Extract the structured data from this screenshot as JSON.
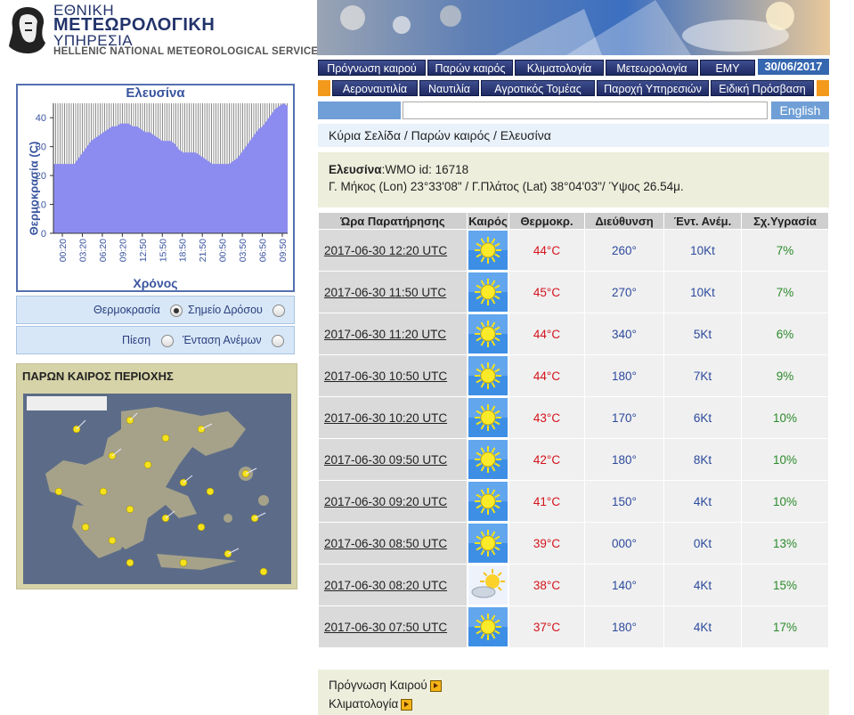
{
  "logo": {
    "line1": "ΕΘΝΙΚΗ",
    "line2": "ΜΕΤΕΩΡΟΛΟΓΙΚΗ",
    "line3": "ΥΠΗΡΕΣΙΑ",
    "line4": "HELLENIC NATIONAL METEOROLOGICAL SERVICE"
  },
  "nav": {
    "row1": [
      "Πρόγνωση καιρού",
      "Παρών καιρός",
      "Κλιματολογία",
      "Μετεωρολογία",
      "ΕΜΥ"
    ],
    "date": "30/06/2017",
    "row2": [
      "Αεροναυτιλία",
      "Ναυτιλία",
      "Αγροτικός Τομέας",
      "Παροχή Υπηρεσιών",
      "Ειδική Πρόσβαση"
    ]
  },
  "search": {
    "english_label": "English",
    "value": ""
  },
  "breadcrumb": "Κύρια Σελίδα / Παρών καιρός / Ελευσίνα",
  "station": {
    "name": "Ελευσίνα",
    "wmo": ":WMO id: 16718",
    "coords": "Γ. Μήκος (Lon) 23°33'08\" / Γ.Πλάτος (Lat) 38°04'03\"/ Ύψος 26.54μ."
  },
  "table": {
    "headers": [
      "Ώρα Παρατήρησης",
      "Καιρός",
      "Θερμοκρ.",
      "Διεύθυνση",
      "Έντ. Ανέμ.",
      "Σχ.Υγρασία"
    ],
    "rows": [
      {
        "time": "2017-06-30 12:20 UTC",
        "icon": "sun-icon",
        "temp": "44°C",
        "dir": "260°",
        "wind": "10Kt",
        "hum": "7%"
      },
      {
        "time": "2017-06-30 11:50 UTC",
        "icon": "sun-icon",
        "temp": "45°C",
        "dir": "270°",
        "wind": "10Kt",
        "hum": "7%"
      },
      {
        "time": "2017-06-30 11:20 UTC",
        "icon": "sun-icon",
        "temp": "44°C",
        "dir": "340°",
        "wind": "5Kt",
        "hum": "6%"
      },
      {
        "time": "2017-06-30 10:50 UTC",
        "icon": "sun-icon",
        "temp": "44°C",
        "dir": "180°",
        "wind": "7Kt",
        "hum": "9%"
      },
      {
        "time": "2017-06-30 10:20 UTC",
        "icon": "sun-icon",
        "temp": "43°C",
        "dir": "170°",
        "wind": "6Kt",
        "hum": "10%"
      },
      {
        "time": "2017-06-30 09:50 UTC",
        "icon": "sun-icon",
        "temp": "42°C",
        "dir": "180°",
        "wind": "8Kt",
        "hum": "10%"
      },
      {
        "time": "2017-06-30 09:20 UTC",
        "icon": "sun-icon",
        "temp": "41°C",
        "dir": "150°",
        "wind": "4Kt",
        "hum": "10%"
      },
      {
        "time": "2017-06-30 08:50 UTC",
        "icon": "sun-icon",
        "temp": "39°C",
        "dir": "000°",
        "wind": "0Kt",
        "hum": "13%"
      },
      {
        "time": "2017-06-30 08:20 UTC",
        "icon": "sun-cloud-icon",
        "temp": "38°C",
        "dir": "140°",
        "wind": "4Kt",
        "hum": "15%"
      },
      {
        "time": "2017-06-30 07:50 UTC",
        "icon": "sun-icon",
        "temp": "37°C",
        "dir": "180°",
        "wind": "4Kt",
        "hum": "17%"
      }
    ]
  },
  "bottom_links": [
    "Πρόγνωση Καιρού",
    "Κλιματολογία"
  ],
  "chart_panel": {
    "title": "Ελευσίνα",
    "ylabel": "Θερμοκρασία (C)",
    "xlabel": "Χρόνος"
  },
  "radios": {
    "row1": [
      {
        "label": "Θερμοκρασία",
        "selected": true
      },
      {
        "label": "Σημείο Δρόσου",
        "selected": false
      }
    ],
    "row2": [
      {
        "label": "Πίεση",
        "selected": false
      },
      {
        "label": "Ένταση Ανέμων",
        "selected": false
      }
    ]
  },
  "region": {
    "title": "ΠΑΡΩΝ ΚΑΙΡΟΣ ΠΕΡΙΟΧΗΣ"
  },
  "colors": {
    "nav_blue": "#1e2a63",
    "chart_fill": "#8c8cf0",
    "temp_red": "#d4121b",
    "hum_green": "#2b8a2b"
  },
  "chart_data": {
    "type": "area",
    "title": "Ελευσίνα",
    "xlabel": "Χρόνος",
    "ylabel": "Θερμοκρασία (C)",
    "ylim": [
      0,
      45
    ],
    "yticks": [
      0,
      10,
      20,
      30,
      40
    ],
    "xticks": [
      "00:20",
      "03:20",
      "06:20",
      "09:20",
      "12:50",
      "15:50",
      "18:50",
      "21:50",
      "00:50",
      "03:50",
      "06:50",
      "09:50"
    ],
    "series": [
      {
        "values": [
          24,
          24,
          24,
          24,
          24,
          24,
          26,
          28,
          30,
          32,
          33,
          34,
          35,
          36,
          37,
          37,
          38,
          38,
          38,
          37,
          37,
          36,
          35,
          35,
          34,
          33,
          32,
          32,
          32,
          31,
          29,
          28,
          28,
          28,
          28,
          27,
          26,
          25,
          24,
          24,
          24,
          24,
          24,
          25,
          26,
          28,
          30,
          32,
          34,
          36,
          37,
          39,
          41,
          43,
          44,
          45,
          44
        ]
      }
    ],
    "grid": true
  }
}
